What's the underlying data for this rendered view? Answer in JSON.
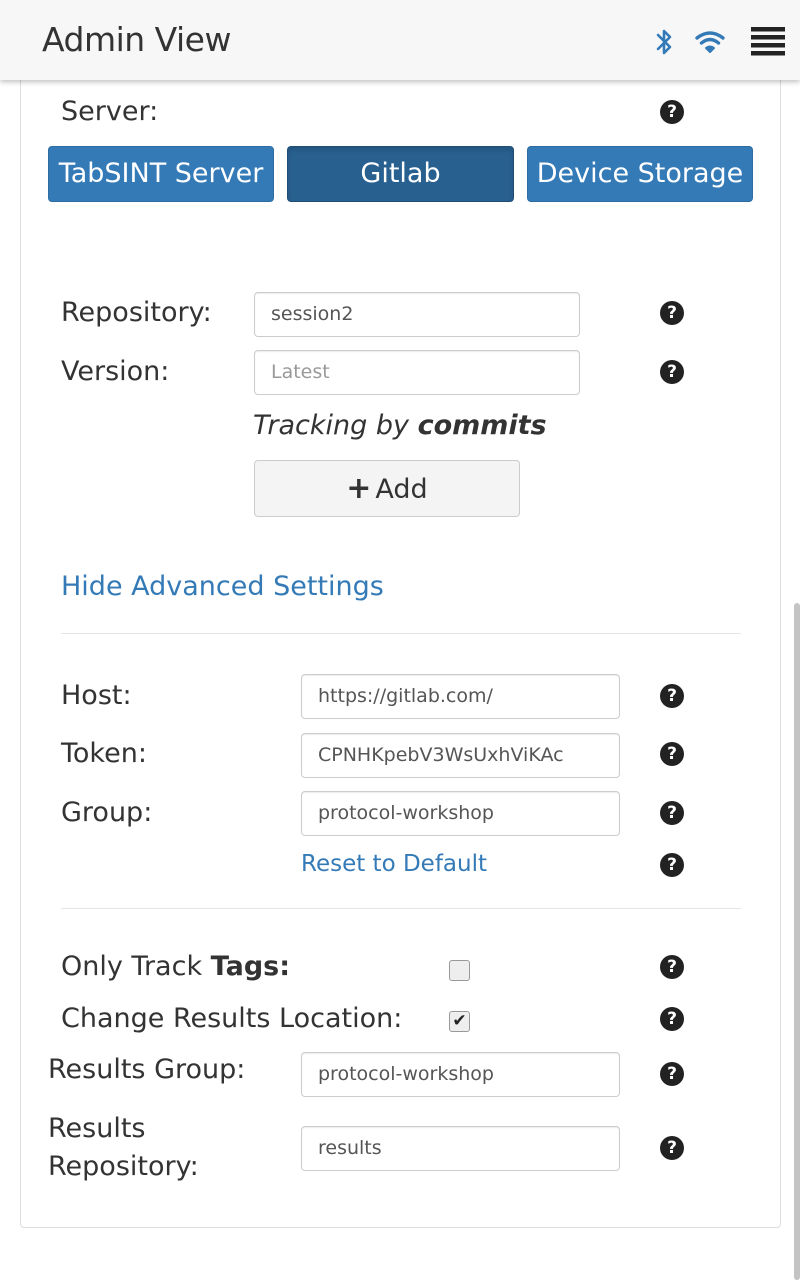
{
  "header": {
    "title": "Admin View"
  },
  "icons": {
    "bluetooth": "bluetooth-icon",
    "wifi": "wifi-icon",
    "menu": "menu-icon",
    "help": "question-circle-icon"
  },
  "colors": {
    "primary": "#337ab7",
    "primary_active": "#286090",
    "link": "#337ab7"
  },
  "server": {
    "label": "Server:",
    "buttons": [
      {
        "label": "TabSINT Server",
        "active": false
      },
      {
        "label": "Gitlab",
        "active": true
      },
      {
        "label": "Device Storage",
        "active": false
      }
    ]
  },
  "repository": {
    "label": "Repository:",
    "value": "session2"
  },
  "version": {
    "label": "Version:",
    "placeholder": "Latest"
  },
  "tracking": {
    "prefix": "Tracking by",
    "mode": "commits"
  },
  "add_button": {
    "icon": "+",
    "label": "Add"
  },
  "advanced_toggle": "Hide Advanced Settings",
  "host": {
    "label": "Host:",
    "value": "https://gitlab.com/"
  },
  "token": {
    "label": "Token:",
    "value": "CPNHKpebV3WsUxhViKAc"
  },
  "group": {
    "label": "Group:",
    "value": "protocol-workshop"
  },
  "reset_link": "Reset to Default",
  "only_track_tags": {
    "label_prefix": "Only Track",
    "label_bold": "Tags:",
    "checked": false
  },
  "change_results_location": {
    "label": "Change Results Location:",
    "checked": true
  },
  "results_group": {
    "label": "Results Group:",
    "value": "protocol-workshop"
  },
  "results_repository": {
    "label_line1": "Results",
    "label_line2": "Repository:",
    "value": "results"
  }
}
